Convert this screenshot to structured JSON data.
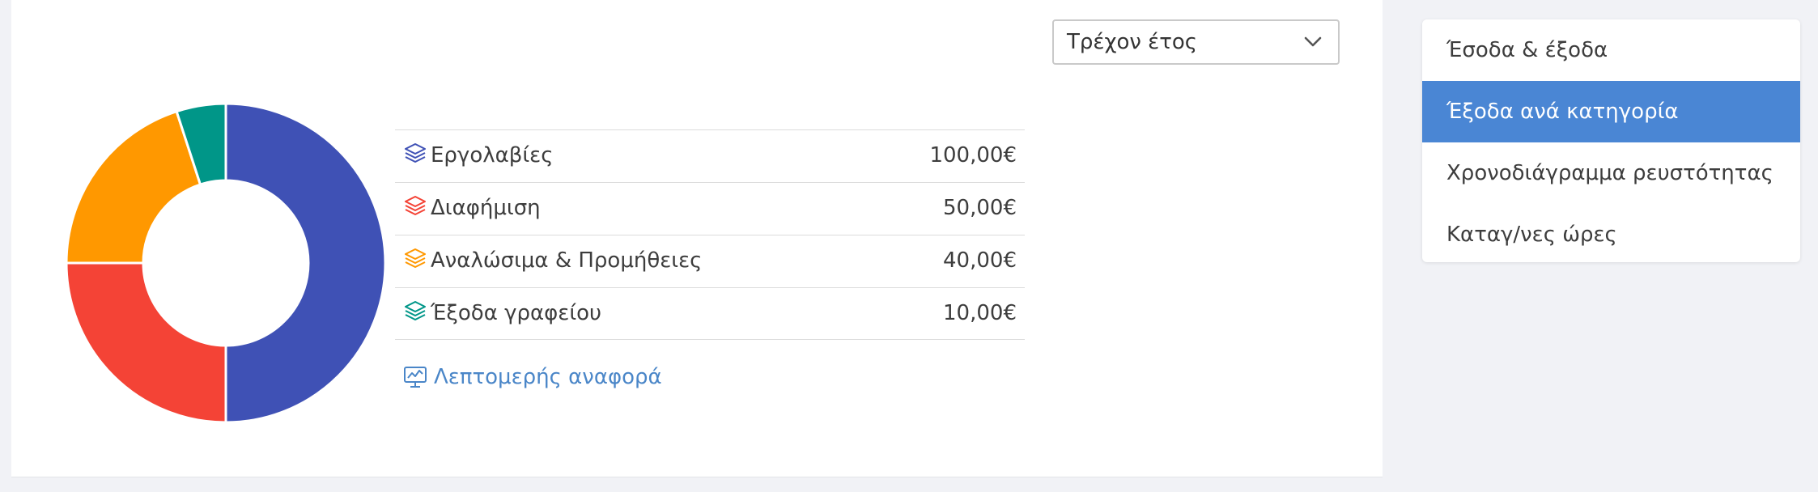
{
  "period_select": {
    "value": "Τρέχον έτος",
    "icon": "chevron-down-icon"
  },
  "chart_data": {
    "type": "pie",
    "hole": true,
    "categories": [
      "Εργολαβίες",
      "Διαφήμιση",
      "Αναλώσιμα & Προμήθειες",
      "Έξοδα γραφείου"
    ],
    "values": [
      100,
      50,
      40,
      10
    ],
    "colors": [
      "#3f51b5",
      "#f44336",
      "#ff9800",
      "#009688"
    ]
  },
  "legend": [
    {
      "label": "Εργολαβίες",
      "amount": "100,00€",
      "color": "#3f51b5",
      "icon": "layers-icon"
    },
    {
      "label": "Διαφήμιση",
      "amount": "50,00€",
      "color": "#f44336",
      "icon": "layers-icon"
    },
    {
      "label": "Αναλώσιμα & Προμήθειες",
      "amount": "40,00€",
      "color": "#ff9800",
      "icon": "layers-icon"
    },
    {
      "label": "Έξοδα γραφείου",
      "amount": "10,00€",
      "color": "#009688",
      "icon": "layers-icon"
    }
  ],
  "report_link": {
    "label": "Λεπτομερής αναφορά",
    "icon": "monitor-chart-icon",
    "color": "#4a86c8"
  },
  "side_menu": {
    "active_index": 1,
    "accent": "#4a86d4",
    "items": [
      {
        "label": "Έσοδα & έξοδα"
      },
      {
        "label": "Έξοδα ανά κατηγορία"
      },
      {
        "label": "Χρονοδιάγραμμα ρευστότητας"
      },
      {
        "label": "Καταγ/νες ώρες"
      }
    ]
  }
}
